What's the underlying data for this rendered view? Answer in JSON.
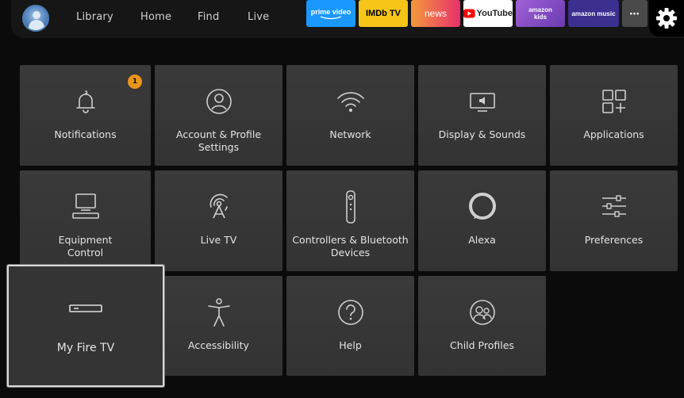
{
  "nav": {
    "items": [
      {
        "label": "Library"
      },
      {
        "label": "Home"
      },
      {
        "label": "Find"
      },
      {
        "label": "Live"
      }
    ]
  },
  "apps": [
    {
      "label": "prime video",
      "bg": "#1a98ff",
      "fg": "#ffffff"
    },
    {
      "label": "IMDb TV",
      "bg": "#f5c518",
      "fg": "#000000"
    },
    {
      "label": "news",
      "bg": "#f25c3b",
      "fg": "#ffffff"
    },
    {
      "label": "YouTube",
      "bg": "#ffffff",
      "fg": "#222222"
    },
    {
      "label": "amazon kids",
      "bg": "#8a4fc7",
      "fg": "#ffffff"
    },
    {
      "label": "amazon music",
      "bg": "#3b2f8f",
      "fg": "#ffffff"
    },
    {
      "label": "•••",
      "bg": "#4a4a4a",
      "fg": "#ffffff"
    }
  ],
  "settings": {
    "tiles": [
      {
        "label_1": "Notifications",
        "label_2": "",
        "icon": "bell-icon",
        "badge": "1"
      },
      {
        "label_1": "Account & Profile",
        "label_2": "Settings",
        "icon": "profile-icon"
      },
      {
        "label_1": "Network",
        "label_2": "",
        "icon": "wifi-icon"
      },
      {
        "label_1": "Display & Sounds",
        "label_2": "",
        "icon": "display-icon"
      },
      {
        "label_1": "Applications",
        "label_2": "",
        "icon": "apps-grid-icon"
      },
      {
        "label_1": "Equipment",
        "label_2": "Control",
        "icon": "equipment-icon"
      },
      {
        "label_1": "Live TV",
        "label_2": "",
        "icon": "antenna-icon"
      },
      {
        "label_1": "Controllers & Bluetooth",
        "label_2": "Devices",
        "icon": "remote-icon"
      },
      {
        "label_1": "Alexa",
        "label_2": "",
        "icon": "alexa-icon"
      },
      {
        "label_1": "Preferences",
        "label_2": "",
        "icon": "sliders-icon"
      },
      {
        "label_1": "My Fire TV",
        "label_2": "",
        "icon": "fire-tv-device-icon"
      },
      {
        "label_1": "Accessibility",
        "label_2": "",
        "icon": "accessibility-icon"
      },
      {
        "label_1": "Help",
        "label_2": "",
        "icon": "help-icon"
      },
      {
        "label_1": "Child Profiles",
        "label_2": "",
        "icon": "child-profiles-icon"
      }
    ]
  },
  "colors": {
    "focus_border": "#d9d9d9",
    "badge": "#e8951c",
    "tile_bg": "#373737"
  }
}
